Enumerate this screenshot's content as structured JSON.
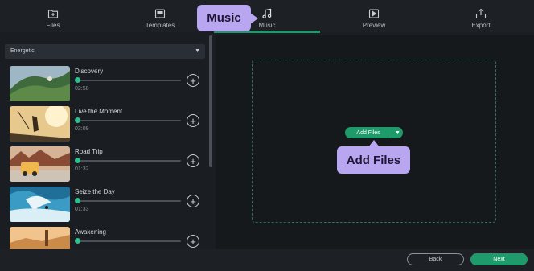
{
  "tabs": [
    {
      "label": "Files",
      "icon": "files-icon"
    },
    {
      "label": "Templates",
      "icon": "templates-icon"
    },
    {
      "label": "Music",
      "icon": "music-icon"
    },
    {
      "label": "Preview",
      "icon": "preview-icon"
    },
    {
      "label": "Export",
      "icon": "export-icon"
    }
  ],
  "active_tab": "Music",
  "callouts": {
    "music": "Music",
    "add_files": "Add Files"
  },
  "genre_dropdown": {
    "selected": "Energetic"
  },
  "tracks": [
    {
      "title": "Discovery",
      "duration": "02:58"
    },
    {
      "title": "Live the Moment",
      "duration": "03:09"
    },
    {
      "title": "Road Trip",
      "duration": "01:32"
    },
    {
      "title": "Seize the Day",
      "duration": "01:33"
    },
    {
      "title": "Awakening",
      "duration": ""
    }
  ],
  "add_files_button": {
    "label": "Add Files"
  },
  "footer": {
    "back_label": "Back",
    "next_label": "Next"
  },
  "colors": {
    "accent": "#1f9b6b",
    "callout": "#b9a6f0",
    "background": "#1a1e22"
  }
}
